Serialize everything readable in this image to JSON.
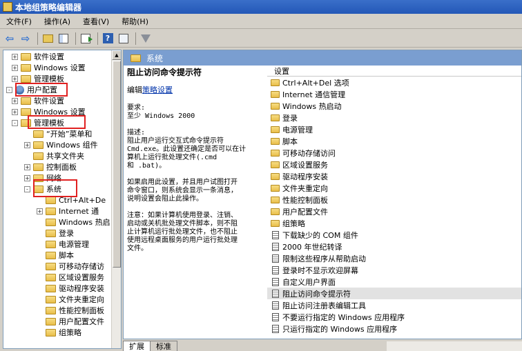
{
  "window": {
    "title": "本地组策略编辑器"
  },
  "menu": [
    "文件(F)",
    "操作(A)",
    "查看(V)",
    "帮助(H)"
  ],
  "tree": [
    {
      "label": "软件设置",
      "exp": "+",
      "icon": "folder",
      "indent": 0
    },
    {
      "label": "Windows 设置",
      "exp": "+",
      "icon": "folder",
      "indent": 0
    },
    {
      "label": "管理模板",
      "exp": "+",
      "icon": "folder",
      "indent": 0
    },
    {
      "label": "用户配置",
      "exp": "-",
      "icon": "user",
      "indent": -1
    },
    {
      "label": "软件设置",
      "exp": "+",
      "icon": "folder",
      "indent": 0
    },
    {
      "label": "Windows 设置",
      "exp": "+",
      "icon": "folder",
      "indent": 0
    },
    {
      "label": "管理模板",
      "exp": "-",
      "icon": "folder",
      "indent": 0
    },
    {
      "label": "“开始”菜单和",
      "exp": "",
      "icon": "folder",
      "indent": 1
    },
    {
      "label": "Windows 组件",
      "exp": "+",
      "icon": "folder",
      "indent": 1
    },
    {
      "label": "共享文件夹",
      "exp": "",
      "icon": "folder",
      "indent": 1
    },
    {
      "label": "控制面板",
      "exp": "+",
      "icon": "folder",
      "indent": 1
    },
    {
      "label": "网络",
      "exp": "+",
      "icon": "folder",
      "indent": 1
    },
    {
      "label": "系统",
      "exp": "-",
      "icon": "folder",
      "indent": 1
    },
    {
      "label": "Ctrl+Alt+De",
      "exp": "",
      "icon": "folder",
      "indent": 2
    },
    {
      "label": "Internet 通",
      "exp": "+",
      "icon": "folder",
      "indent": 2
    },
    {
      "label": "Windows 热启",
      "exp": "",
      "icon": "folder",
      "indent": 2
    },
    {
      "label": "登录",
      "exp": "",
      "icon": "folder",
      "indent": 2
    },
    {
      "label": "电源管理",
      "exp": "",
      "icon": "folder",
      "indent": 2
    },
    {
      "label": "脚本",
      "exp": "",
      "icon": "folder",
      "indent": 2
    },
    {
      "label": "可移动存储访",
      "exp": "",
      "icon": "folder",
      "indent": 2
    },
    {
      "label": "区域设置服务",
      "exp": "",
      "icon": "folder",
      "indent": 2
    },
    {
      "label": "驱动程序安装",
      "exp": "",
      "icon": "folder",
      "indent": 2
    },
    {
      "label": "文件夹重定向",
      "exp": "",
      "icon": "folder",
      "indent": 2
    },
    {
      "label": "性能控制面板",
      "exp": "",
      "icon": "folder",
      "indent": 2
    },
    {
      "label": "用户配置文件",
      "exp": "",
      "icon": "folder",
      "indent": 2
    },
    {
      "label": "组策略",
      "exp": "",
      "icon": "folder",
      "indent": 2
    }
  ],
  "header": {
    "title": "系统"
  },
  "details": {
    "policy_title": "阻止访问命令提示符",
    "edit_prefix": "编辑",
    "edit_link": "策略设置",
    "requirements": [
      "要求:",
      "至少 Windows 2000"
    ],
    "description": [
      "描述:",
      "阻止用户运行交互式命令提示符",
      "Cmd.exe。此设置还确定是否可以在计",
      "算机上运行批处理文件(.cmd",
      "和 .bat)。"
    ],
    "enabled": [
      "如果启用此设置，并且用户试图打开",
      "命令窗口，则系统会显示一条消息，",
      "说明设置会阻止此操作。"
    ],
    "note": [
      "注意：如果计算机使用登录、注销、",
      "启动或关机批处理文件脚本，则不阻",
      "止计算机运行批处理文件，也不阻止",
      "使用远程桌面服务的用户运行批处理",
      "文件。"
    ]
  },
  "list": {
    "column": "设置",
    "rows": [
      {
        "label": "Ctrl+Alt+Del 选项",
        "icon": "folder"
      },
      {
        "label": "Internet 通信管理",
        "icon": "folder"
      },
      {
        "label": "Windows 热启动",
        "icon": "folder"
      },
      {
        "label": "登录",
        "icon": "folder"
      },
      {
        "label": "电源管理",
        "icon": "folder"
      },
      {
        "label": "脚本",
        "icon": "folder"
      },
      {
        "label": "可移动存储访问",
        "icon": "folder"
      },
      {
        "label": "区域设置服务",
        "icon": "folder"
      },
      {
        "label": "驱动程序安装",
        "icon": "folder"
      },
      {
        "label": "文件夹重定向",
        "icon": "folder"
      },
      {
        "label": "性能控制面板",
        "icon": "folder"
      },
      {
        "label": "用户配置文件",
        "icon": "folder"
      },
      {
        "label": "组策略",
        "icon": "folder"
      },
      {
        "label": "下载缺少的 COM 组件",
        "icon": "policy"
      },
      {
        "label": "2000 年世纪转译",
        "icon": "policy"
      },
      {
        "label": "限制这些程序从帮助启动",
        "icon": "policy"
      },
      {
        "label": "登录时不显示欢迎屏幕",
        "icon": "policy"
      },
      {
        "label": "自定义用户界面",
        "icon": "policy"
      },
      {
        "label": "阻止访问命令提示符",
        "icon": "policy",
        "selected": true
      },
      {
        "label": "阻止访问注册表编辑工具",
        "icon": "policy"
      },
      {
        "label": "不要运行指定的 Windows 应用程序",
        "icon": "policy"
      },
      {
        "label": "只运行指定的 Windows 应用程序",
        "icon": "policy"
      }
    ]
  },
  "tabs": [
    "扩展",
    "标准"
  ]
}
